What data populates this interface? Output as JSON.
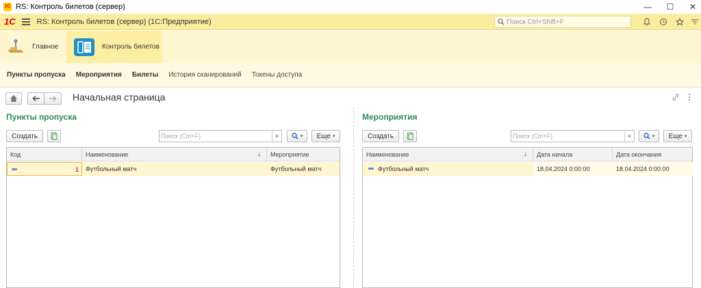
{
  "window": {
    "app_icon": "1C",
    "title": "RS: Контроль билетов (сервер)",
    "minimize": "—",
    "maximize": "☐",
    "close": "✕"
  },
  "header": {
    "logo": "1С",
    "app_title": "RS: Контроль билетов (сервер)  (1С:Предприятие)",
    "search_placeholder": "Поиск Ctrl+Shift+F"
  },
  "sections": [
    {
      "label": "Главное",
      "icon": "home-desk-icon"
    },
    {
      "label": "Контроль билетов",
      "icon": "ticket-control-icon"
    }
  ],
  "function_bar": [
    {
      "label": "Пункты пропуска",
      "bold": true
    },
    {
      "label": "Мероприятия",
      "bold": true
    },
    {
      "label": "Билеты",
      "bold": true
    },
    {
      "label": "История сканирований",
      "bold": false
    },
    {
      "label": "Токены доступа",
      "bold": false
    }
  ],
  "page": {
    "title": "Начальная страница"
  },
  "left_panel": {
    "title": "Пункты пропуска",
    "create_label": "Создать",
    "search_placeholder": "Поиск (Ctrl+F)",
    "clear": "×",
    "more_label": "Еще",
    "columns": [
      "Код",
      "Наименование",
      "Мероприятие"
    ],
    "rows": [
      {
        "code": "1",
        "name": "Футбольный матч",
        "event": "Футбольный матч"
      }
    ]
  },
  "right_panel": {
    "title": "Мероприятия",
    "create_label": "Создать",
    "search_placeholder": "Поиск (Ctrl+F)",
    "clear": "×",
    "more_label": "Еще",
    "columns": [
      "Наименование",
      "Дата начала",
      "Дата окончания"
    ],
    "rows": [
      {
        "name": "Футбольный матч",
        "start": "18.04.2024 0:00:00",
        "end": "18.04.2024 0:00:00"
      }
    ]
  },
  "colors": {
    "header_bg": "#fbed9e",
    "panel_title": "#2e8b57",
    "selected_row": "#fff5cf"
  }
}
